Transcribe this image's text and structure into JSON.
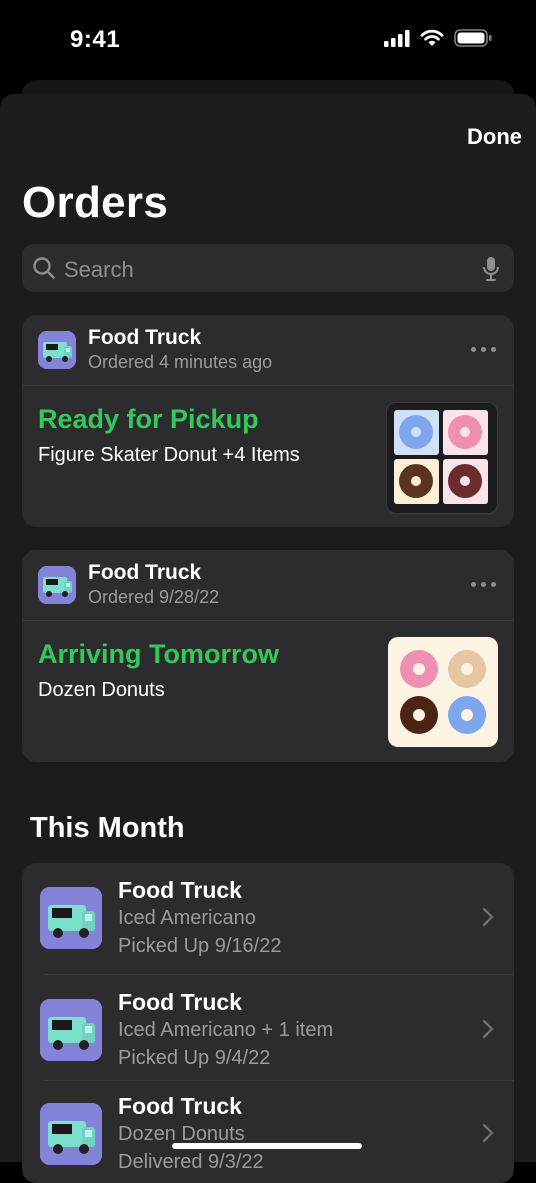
{
  "status_bar": {
    "time": "9:41"
  },
  "sheet": {
    "done_label": "Done",
    "title": "Orders",
    "search": {
      "placeholder": "Search"
    }
  },
  "orders": [
    {
      "vendor": "Food Truck",
      "ordered": "Ordered 4 minutes ago",
      "status": "Ready for Pickup",
      "items": "Figure Skater Donut +4 Items",
      "thumb": "donut-grid-thumbnail"
    },
    {
      "vendor": "Food Truck",
      "ordered": "Ordered 9/28/22",
      "status": "Arriving Tomorrow",
      "items": "Dozen Donuts",
      "thumb": "dozen-donuts-thumbnail"
    }
  ],
  "this_month": {
    "title": "This Month",
    "rows": [
      {
        "vendor": "Food Truck",
        "line1": "Iced Americano",
        "line2": "Picked Up 9/16/22"
      },
      {
        "vendor": "Food Truck",
        "line1": "Iced Americano + 1 item",
        "line2": "Picked Up 9/4/22"
      },
      {
        "vendor": "Food Truck",
        "line1": "Dozen Donuts",
        "line2": "Delivered 9/3/22"
      }
    ]
  },
  "colors": {
    "accent_green": "#34c759",
    "sheet_bg": "#1c1c1e",
    "card_bg": "#2c2c2e",
    "app_icon_bg": "#7f7fd5"
  },
  "icons": [
    "signal-icon",
    "wifi-icon",
    "battery-icon",
    "search-icon",
    "microphone-icon",
    "more-icon",
    "chevron-right-icon",
    "food-truck-icon"
  ]
}
